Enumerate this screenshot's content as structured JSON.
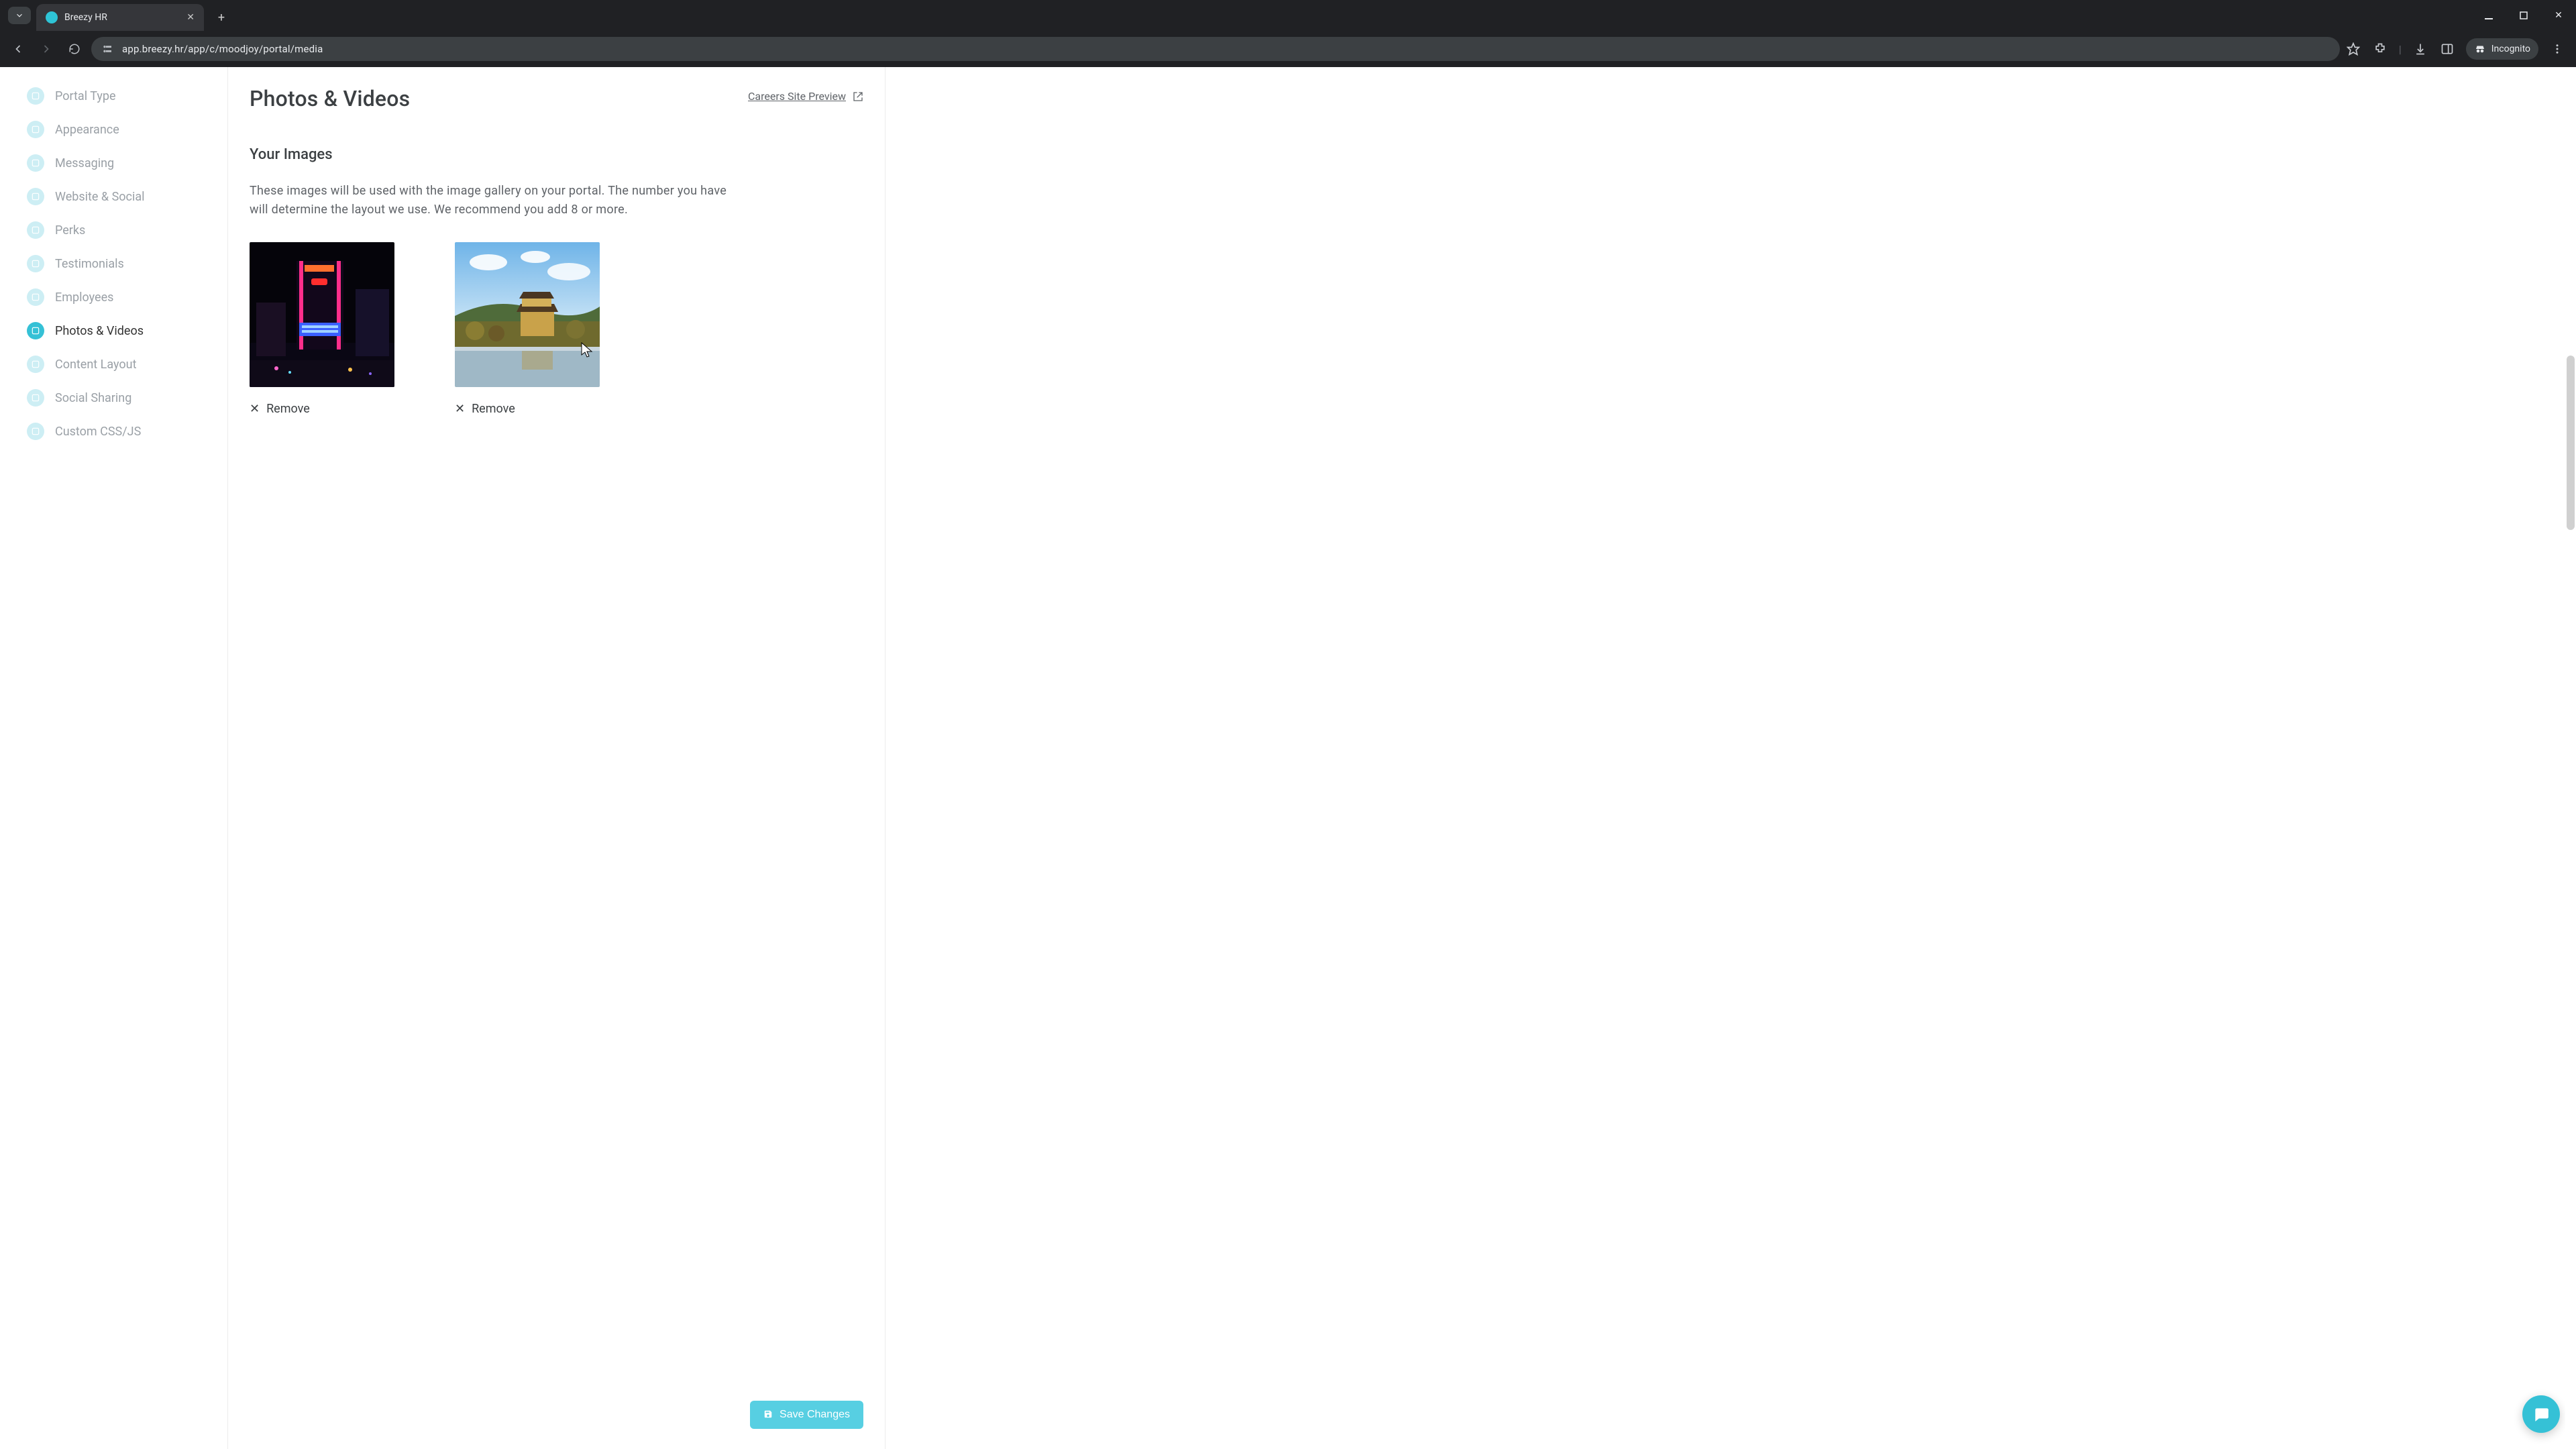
{
  "browser": {
    "tab_title": "Breezy HR",
    "url": "app.breezy.hr/app/c/moodjoy/portal/media",
    "incognito_label": "Incognito"
  },
  "sidebar": {
    "items": [
      {
        "label": "Portal Type",
        "icon": "layout-icon"
      },
      {
        "label": "Appearance",
        "icon": "brush-icon"
      },
      {
        "label": "Messaging",
        "icon": "message-icon"
      },
      {
        "label": "Website & Social",
        "icon": "share-icon"
      },
      {
        "label": "Perks",
        "icon": "perk-icon"
      },
      {
        "label": "Testimonials",
        "icon": "quote-icon"
      },
      {
        "label": "Employees",
        "icon": "people-icon"
      },
      {
        "label": "Photos & Videos",
        "icon": "image-icon",
        "active": true
      },
      {
        "label": "Content Layout",
        "icon": "grid-icon"
      },
      {
        "label": "Social Sharing",
        "icon": "share2-icon"
      },
      {
        "label": "Custom CSS/JS",
        "icon": "code-icon"
      }
    ]
  },
  "page": {
    "title": "Photos & Videos",
    "preview_label": "Careers Site Preview",
    "section_heading": "Your Images",
    "section_desc": "These images will be used with the image gallery on your portal. The number you have will determine the layout we use. We recommend you add 8 or more.",
    "images": [
      {
        "alt": "Citywalk neon night scene",
        "remove_label": "Remove"
      },
      {
        "alt": "Golden Pavilion temple by lake",
        "remove_label": "Remove"
      }
    ],
    "save_label": "Save Changes"
  },
  "colors": {
    "accent": "#35c1d6",
    "accent_light": "#cdeef4",
    "text": "#3c4043",
    "muted": "#9aa0a6"
  }
}
